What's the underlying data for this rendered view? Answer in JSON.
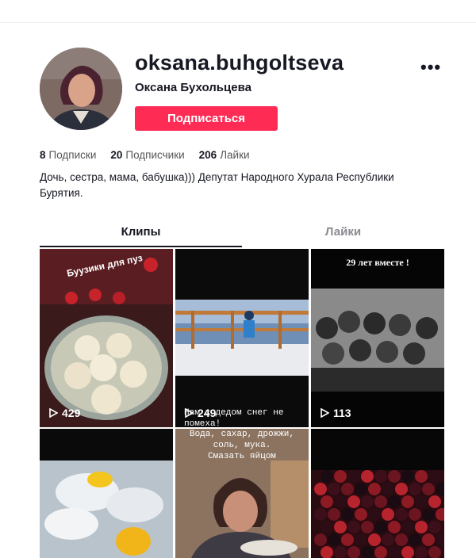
{
  "profile": {
    "username": "oksana.buhgoltseva",
    "full_name": "Оксана Бухольцева",
    "follow_label": "Подписаться",
    "more_label": "•••",
    "stats": [
      {
        "count": "8",
        "label": "Подписки"
      },
      {
        "count": "20",
        "label": "Подписчики"
      },
      {
        "count": "206",
        "label": "Лайки"
      }
    ],
    "bio_line1": "Дочь, сестра, мама, бабушка))) Депутат Народного Хурала Республики",
    "bio_line2": "Бурятия."
  },
  "tabs": [
    {
      "label": "Клипы",
      "active": true
    },
    {
      "label": "Лайки",
      "active": false
    }
  ],
  "videos": [
    {
      "views": "429",
      "caption": "Буузики для пуз"
    },
    {
      "views": "249",
      "caption": ""
    },
    {
      "views": "113",
      "caption": "29 лет вместе !"
    },
    {
      "views": "",
      "caption": ""
    },
    {
      "views": "",
      "caption_lines": [
        "Нам с дедом снег не помеха!",
        "Вода, сахар, дрожжи,",
        "соль, мука.",
        "Смазать яйцом"
      ]
    },
    {
      "views": "",
      "caption": ""
    }
  ],
  "colors": {
    "accent": "#fe2c55",
    "text": "#161823",
    "muted": "#8a8b91"
  }
}
